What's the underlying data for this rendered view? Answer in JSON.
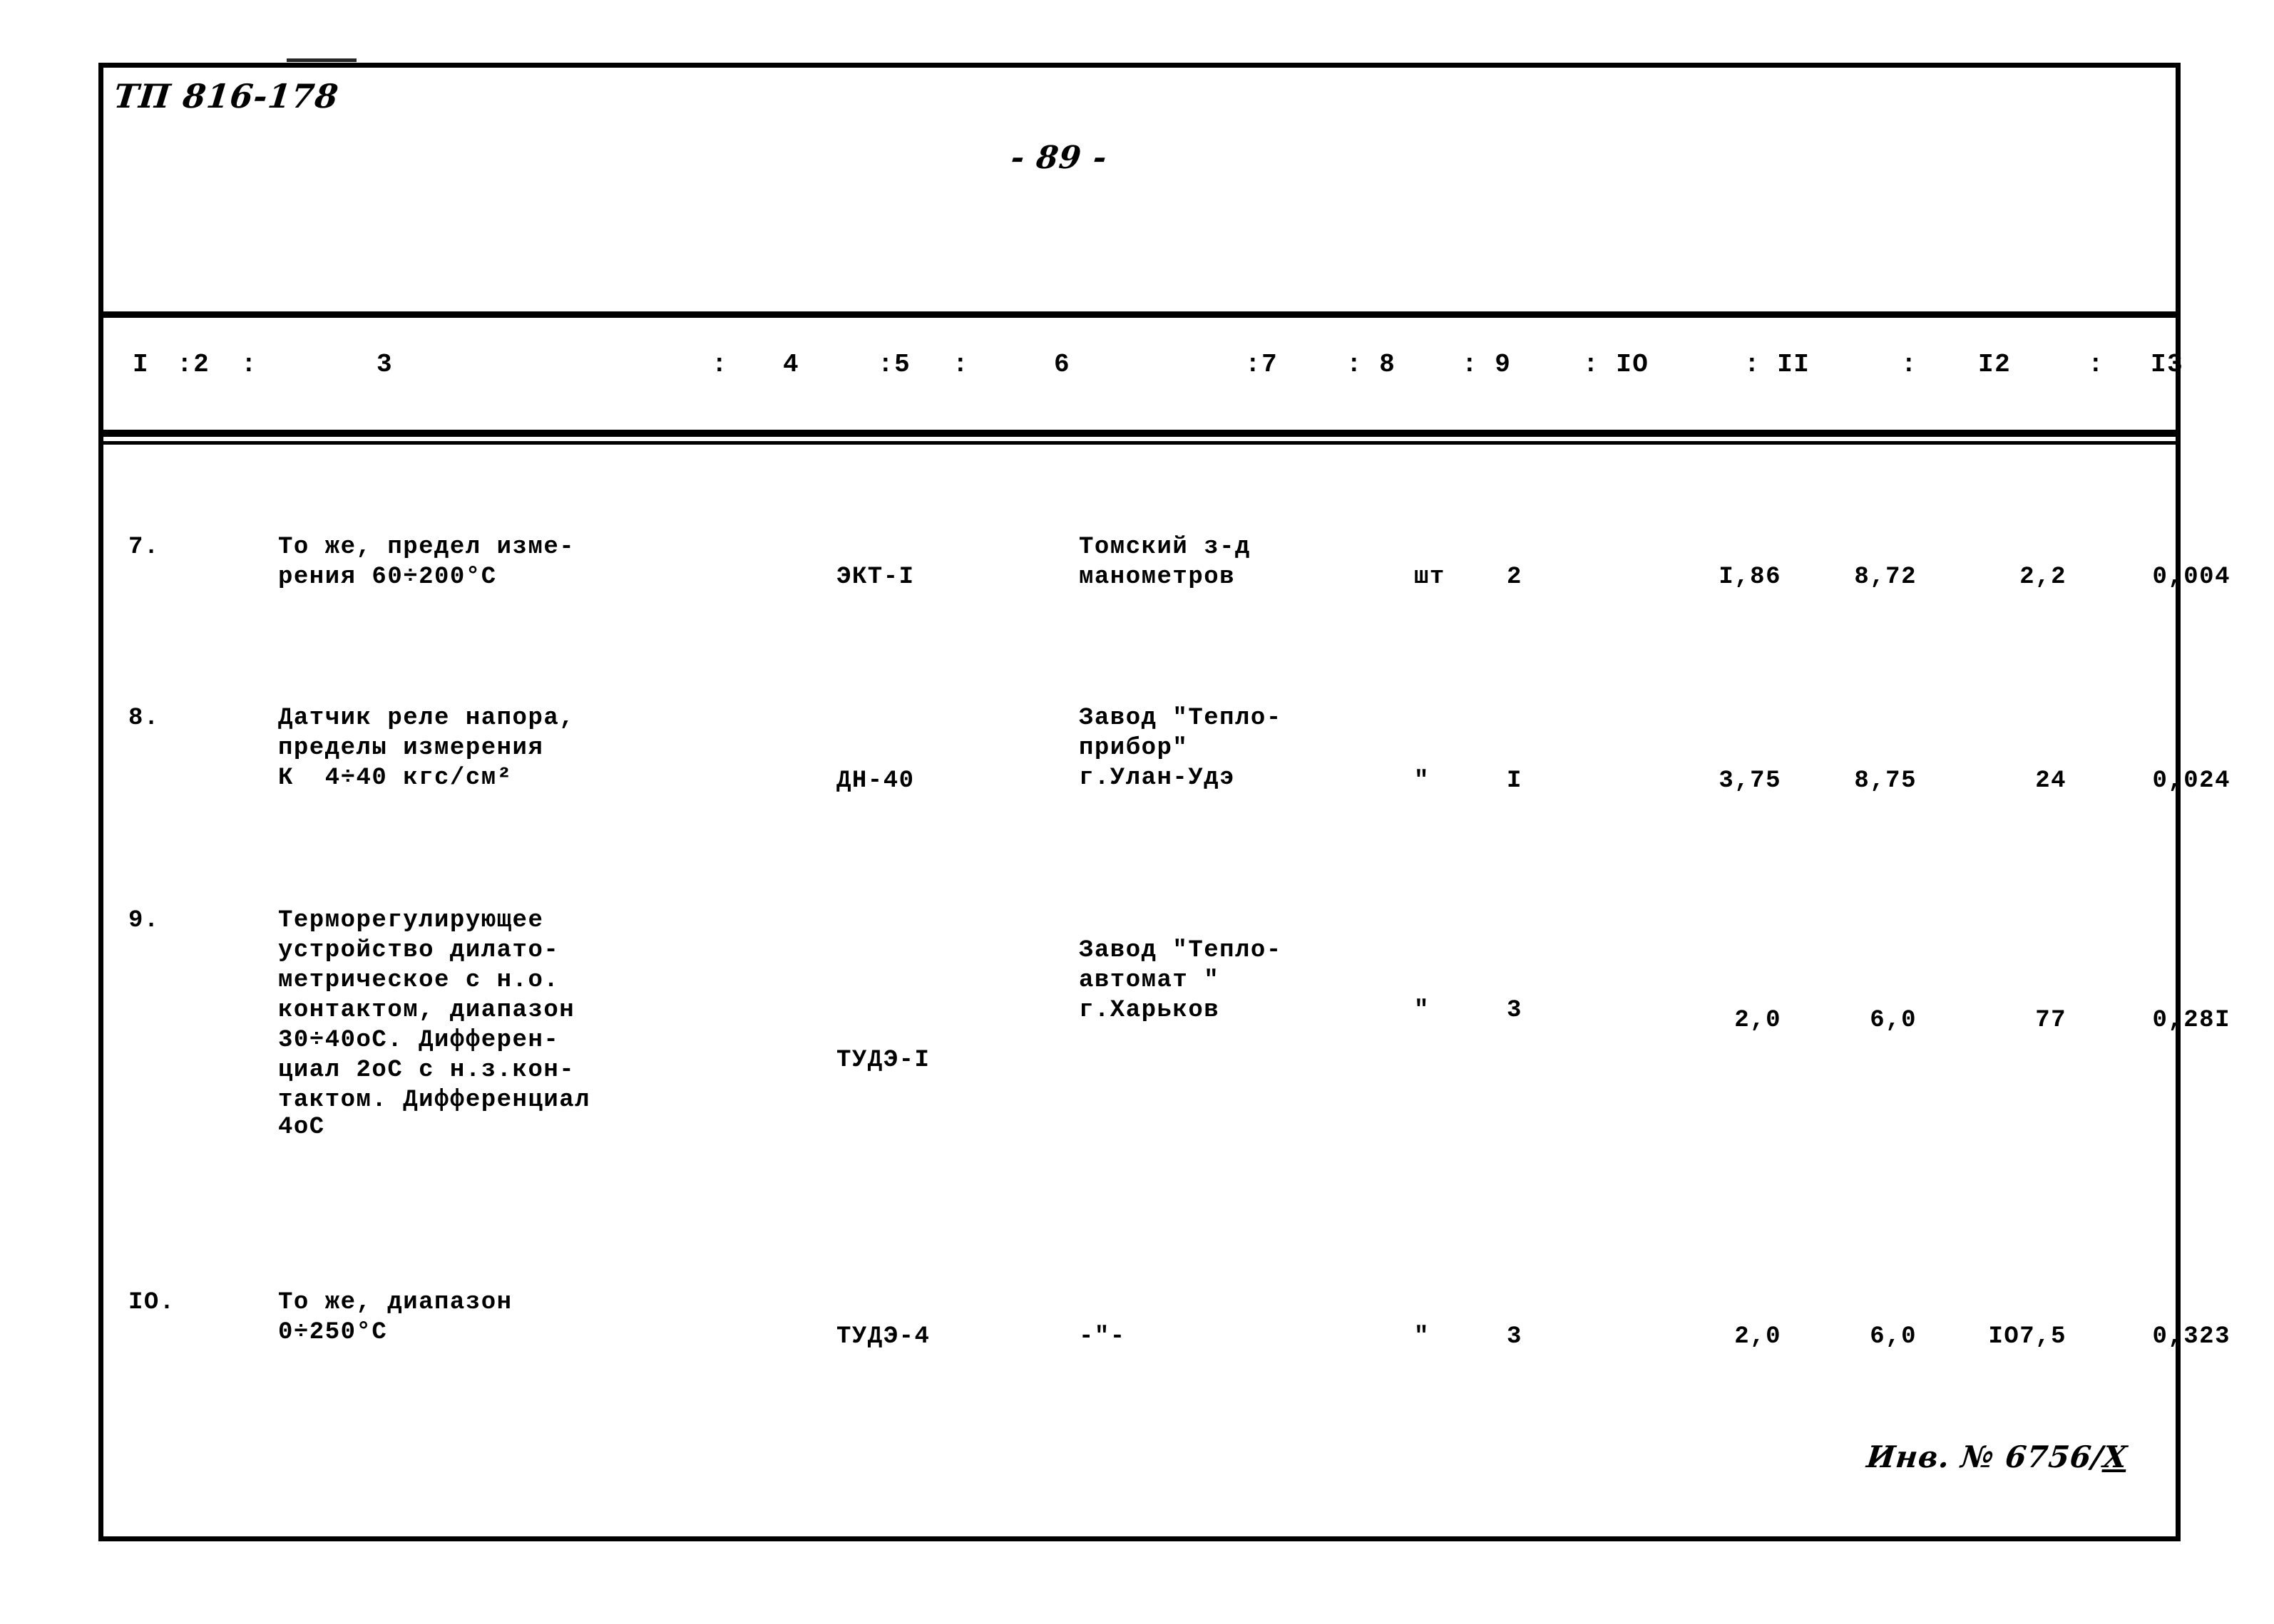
{
  "document": {
    "code": "ТП 816-178",
    "page_number": "- 89 -",
    "inventory_number_prefix": "Инв. № 6756/",
    "inventory_number_suffix": "X"
  },
  "table": {
    "column_numbers": [
      {
        "label": "I"
      },
      {
        "label": ":2"
      },
      {
        "label": ":"
      },
      {
        "label": "3"
      },
      {
        "label": ":"
      },
      {
        "label": "4"
      },
      {
        "label": ":5"
      },
      {
        "label": ":"
      },
      {
        "label": "6"
      },
      {
        "label": ":7"
      },
      {
        "label": ": 8"
      },
      {
        "label": ": 9"
      },
      {
        "label": ": IO"
      },
      {
        "label": ": II"
      },
      {
        "label": ":"
      },
      {
        "label": "I2"
      },
      {
        "label": ":"
      },
      {
        "label": "I3"
      }
    ],
    "rows": [
      {
        "no": "7.",
        "description_lines": [
          "То же, предел изме-",
          "рения 60÷200°С"
        ],
        "type": "ЭКТ-I",
        "manufacturer_lines": [
          "Томский з-д",
          "манометров"
        ],
        "unit": "шт",
        "qty": "2",
        "col9": "I,86",
        "col10": "8,72",
        "col11": "2,2",
        "col12": "0,004"
      },
      {
        "no": "8.",
        "description_lines": [
          "Датчик реле напора,",
          "пределы измерения",
          "К  4÷40 кгс/см²"
        ],
        "type": "ДН-40",
        "manufacturer_lines": [
          "Завод \"Тепло-",
          "прибор\"",
          "г.Улан-Удэ"
        ],
        "unit": "\"",
        "qty": "I",
        "col9": "3,75",
        "col10": "8,75",
        "col11": "24",
        "col12": "0,024"
      },
      {
        "no": "9.",
        "description_lines": [
          "Терморегулирующее",
          "устройство дилато-",
          "метрическое с н.о.",
          "контактом, диапазон",
          "30÷40оС. Дифферен-",
          "циал 2оС с н.з.кон-",
          "тактом. Дифференциал",
          "4оС"
        ],
        "type": "ТУДЭ-I",
        "manufacturer_lines": [
          "Завод \"Тепло-",
          "автомат \"",
          "г.Харьков"
        ],
        "unit": "\"",
        "qty": "3",
        "col9": "2,0",
        "col10": "6,0",
        "col11": "77",
        "col12": "0,28I"
      },
      {
        "no": "IО.",
        "description_lines": [
          "То же, диапазон",
          "0÷250°С"
        ],
        "type": "ТУДЭ-4",
        "manufacturer_lines": [
          "-\"-"
        ],
        "unit": "\"",
        "qty": "3",
        "col9": "2,0",
        "col10": "6,0",
        "col11": "IО7,5",
        "col12": "0,323"
      }
    ]
  }
}
